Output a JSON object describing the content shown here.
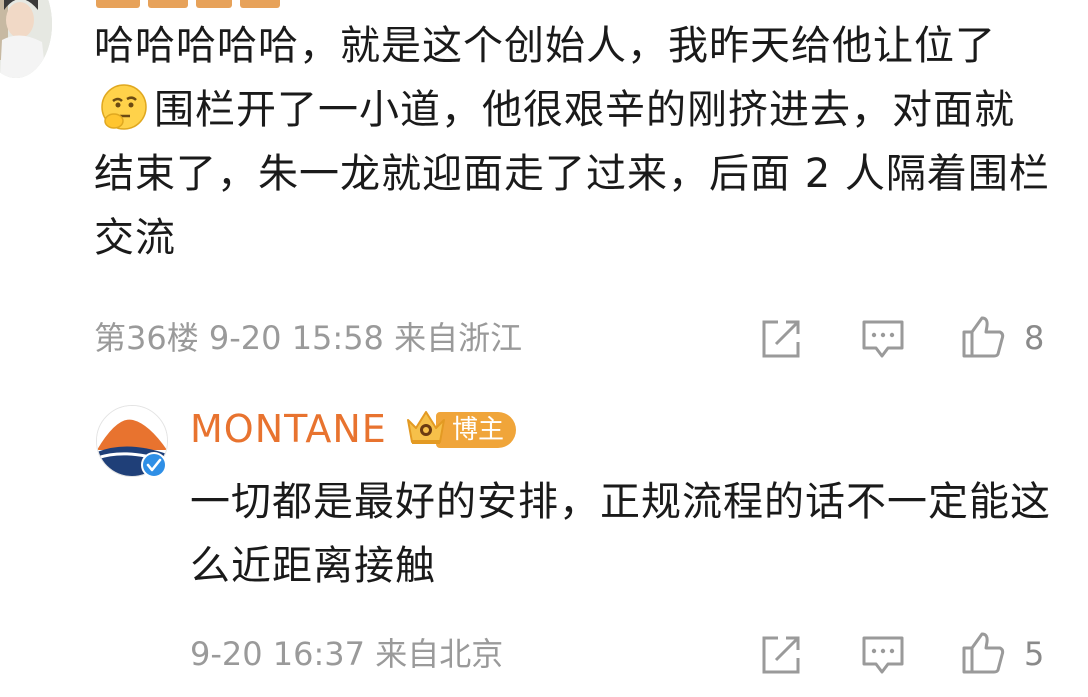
{
  "comment1": {
    "text": "哈哈哈哈哈，就是这个创始人，我昨天给他让位了",
    "text_after_emoji": "围栏开了一小道，他很艰辛的刚挤进去，对面就结束了，朱一龙就迎面走了过来，后面 2 人隔着围栏交流",
    "emoji": "thinking-emoji",
    "meta": "第36楼 9-20 15:58 来自浙江",
    "like_count": "8"
  },
  "reply": {
    "username": "MONTANE",
    "badge": "博主",
    "text": "一切都是最好的安排，正规流程的话不一定能这么近距离接触",
    "meta": "9-20 16:37 来自北京",
    "like_count": "5"
  },
  "icons": [
    "share-icon",
    "comment-icon",
    "like-icon",
    "verified-icon",
    "crown-icon"
  ],
  "colors": {
    "username": "#e8732f",
    "badge_bg": "#f0a53a",
    "meta": "#9a9a9a",
    "text": "#1a1a1a",
    "verified": "#2f8fe6"
  }
}
